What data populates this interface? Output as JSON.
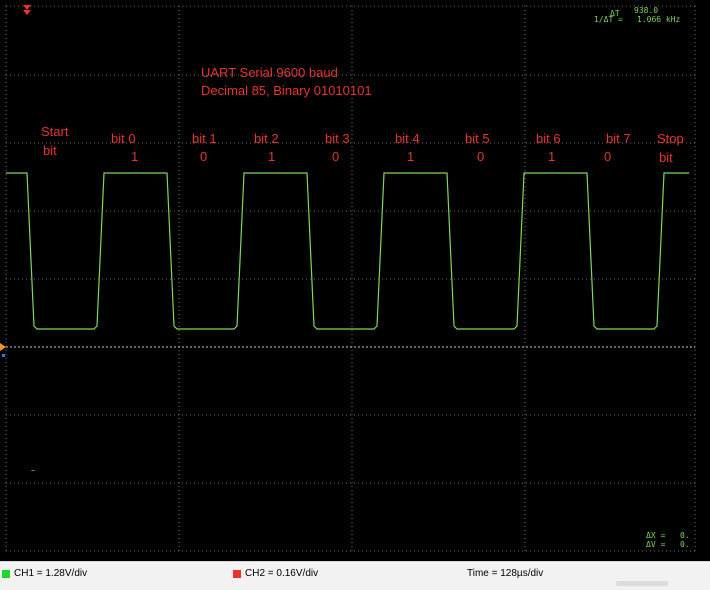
{
  "colors": {
    "background": "#000000",
    "grid": "#8c8c8c",
    "trace": "#7ed957",
    "annotation": "#e8342c",
    "marker": "#e8342c",
    "ground_marker": "#f7941d",
    "status_bar": "#f2f2f2",
    "ch1_swatch": "#1fd82a",
    "ch2_swatch": "#e8342c"
  },
  "icons": {
    "trigger_marker": "trigger-arrow-icon",
    "ground_marker": "ground-level-marker-icon"
  },
  "annotations": {
    "title_line1": "UART Serial 9600 baud",
    "title_line2": "Decimal 85, Binary 01010101",
    "start_label_line1": "Start",
    "start_label_line2": "bit",
    "stop_label_line1": "Stop",
    "stop_label_line2": "bit",
    "bits": [
      {
        "label": "bit 0",
        "value": "1"
      },
      {
        "label": "bit 1",
        "value": "0"
      },
      {
        "label": "bit 2",
        "value": "1"
      },
      {
        "label": "bit 3",
        "value": "0"
      },
      {
        "label": "bit 4",
        "value": "1"
      },
      {
        "label": "bit 5",
        "value": "0"
      },
      {
        "label": "bit 6",
        "value": "1"
      },
      {
        "label": "bit 7",
        "value": "0"
      }
    ]
  },
  "measurement": {
    "delta_t_label": "ΔT",
    "delta_t_value": "938.0",
    "freq_label": "1/ΔT =",
    "freq_value": "1.066 kHz",
    "x_label": "ΔX =",
    "x_value": "0.",
    "v_label": "ΔV =",
    "v_value": "0."
  },
  "status": {
    "ch1": "CH1 = 1.28V/div",
    "ch2": "CH2 = 0.16V/div",
    "time": "Time = 128µs/div"
  },
  "waveform": {
    "description_levels": [
      "high",
      "low",
      "high",
      "low",
      "high",
      "low",
      "high",
      "low",
      "high",
      "low",
      "high"
    ],
    "bit_sequence": [
      "start",
      "1",
      "0",
      "1",
      "0",
      "1",
      "0",
      "1",
      "0",
      "stop"
    ]
  }
}
